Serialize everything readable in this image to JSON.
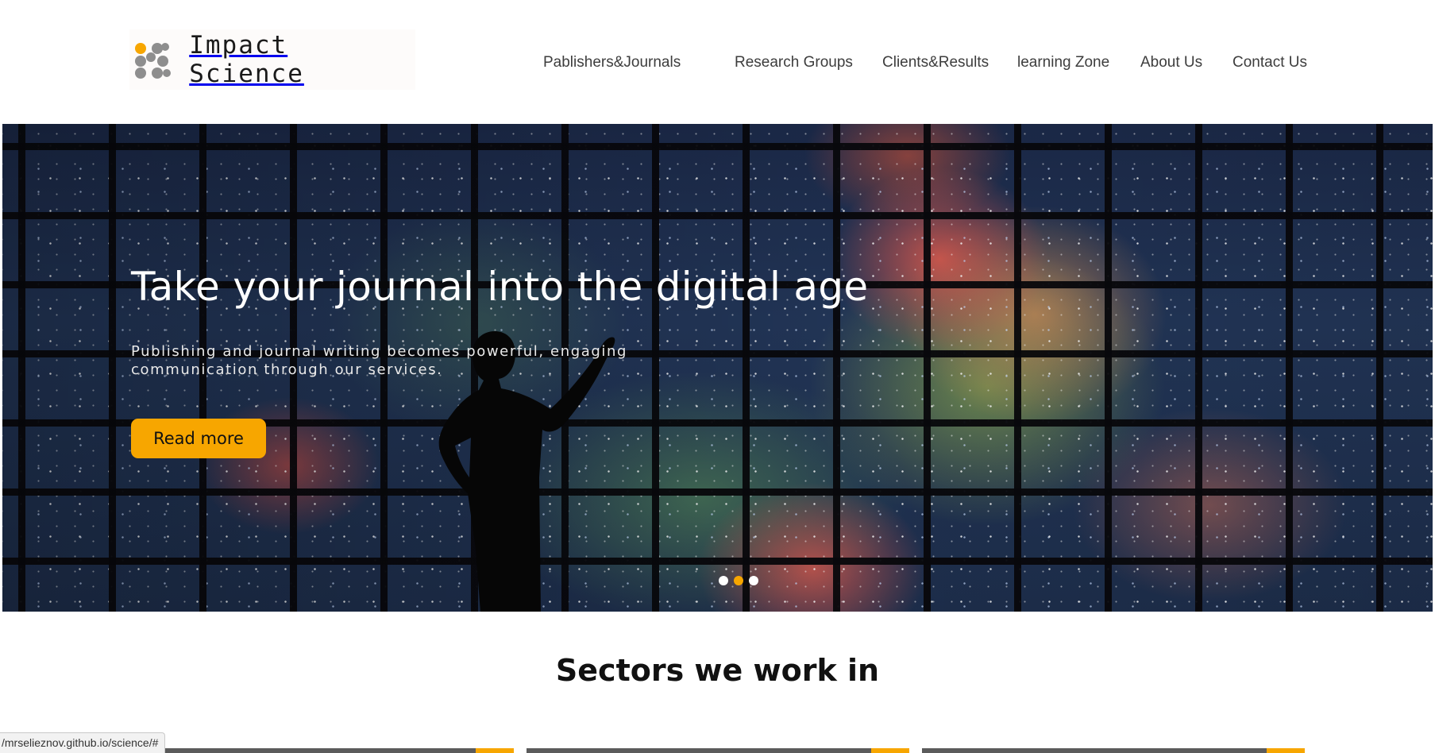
{
  "brand": {
    "logo_text": "Impact Science"
  },
  "nav": {
    "items": [
      {
        "label": "Pablishers&Journals"
      },
      {
        "label": "Research Groups"
      },
      {
        "label": "Clients&Results"
      },
      {
        "label": "learning Zone"
      },
      {
        "label": "About Us"
      },
      {
        "label": "Contact Us"
      }
    ]
  },
  "hero": {
    "title": "Take your journal into the digital age",
    "subtitle": "Publishing and journal writing becomes powerful, engaging communication through our services.",
    "button_label": "Read more",
    "slides_total": 3,
    "active_slide": 2
  },
  "sectors": {
    "heading": "Sectors we work in"
  },
  "status_bar": {
    "url": "/mrselieznov.github.io/science/#"
  },
  "colors": {
    "accent": "#f7a600",
    "text_dark": "#111111",
    "nav_text": "#3d3d3d",
    "logo_dots": "#8e8e8e"
  },
  "icons": {
    "logo_mark": "dot-grid-logo-icon"
  }
}
